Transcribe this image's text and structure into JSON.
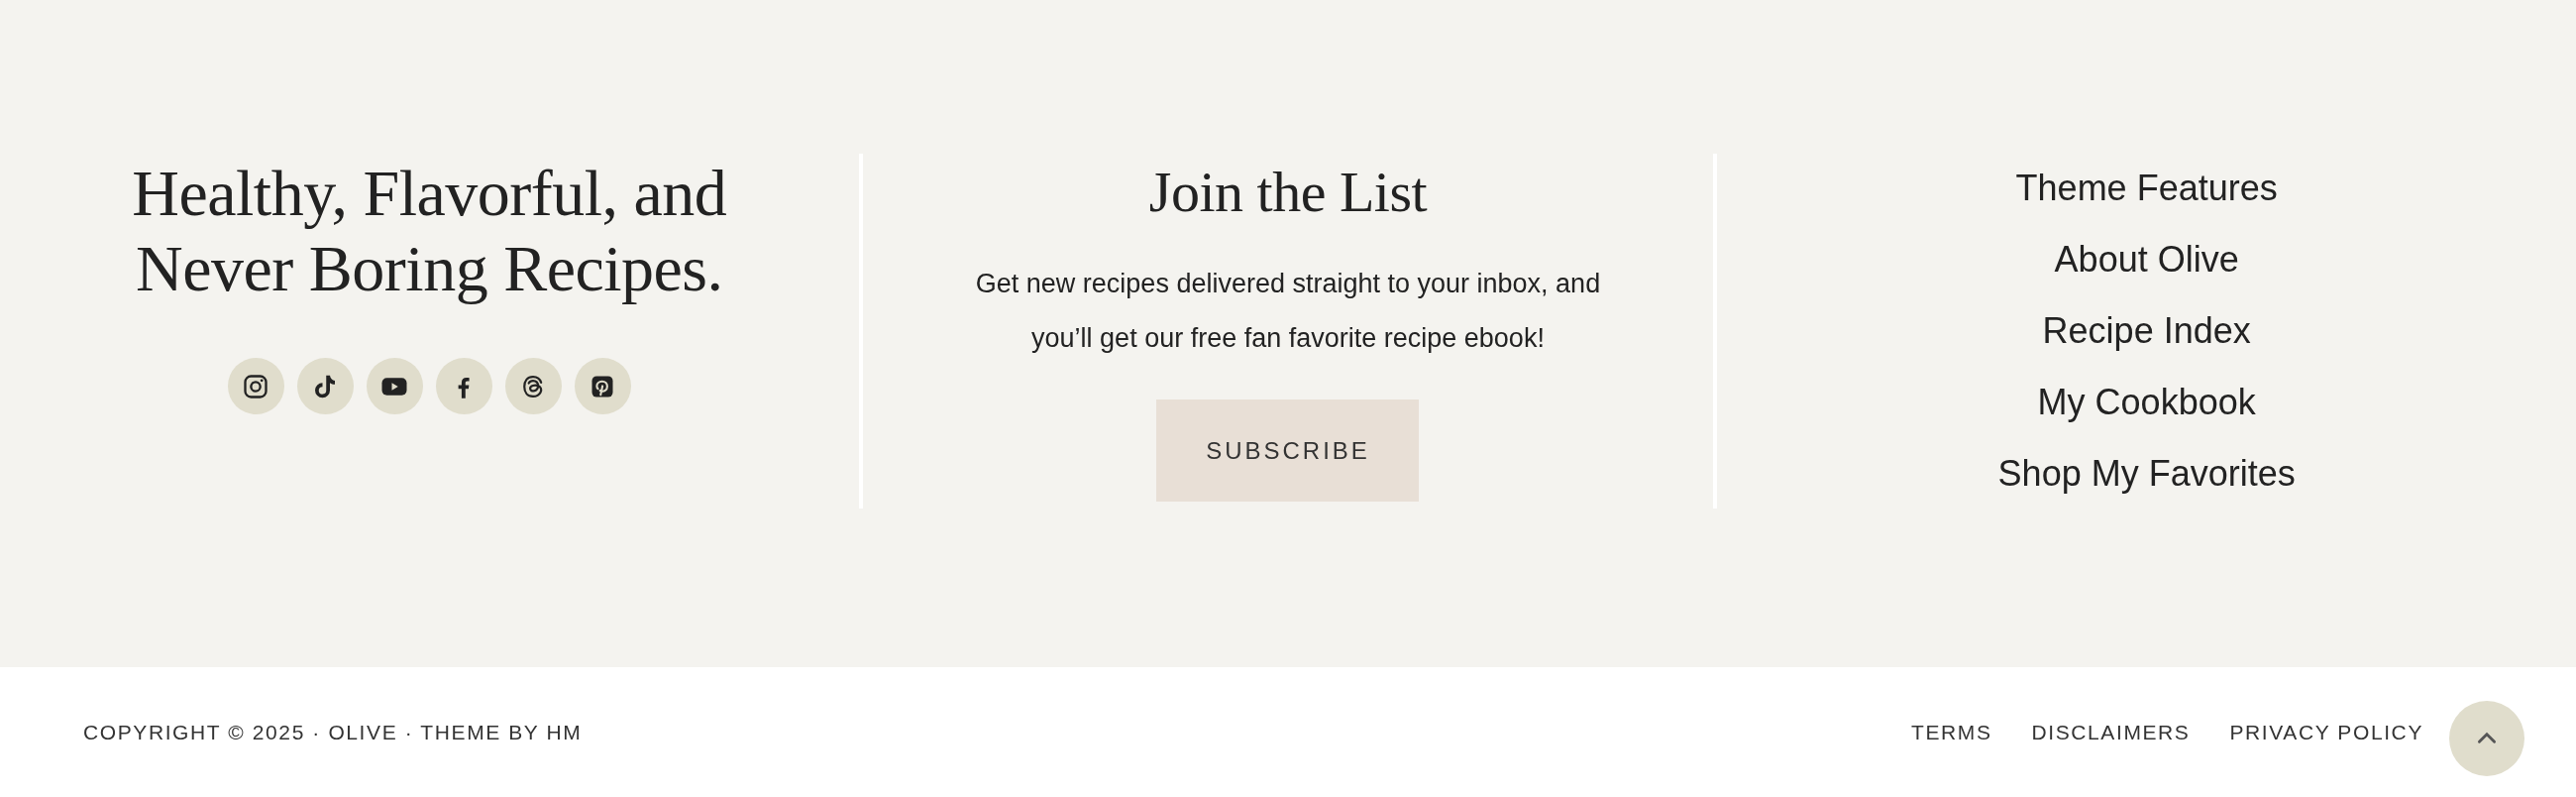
{
  "brand": {
    "heading_lines": [
      "Healthy, Flavorful, and",
      "Never Boring Recipes."
    ],
    "social_links": [
      {
        "kind": "instagram"
      },
      {
        "kind": "tiktok"
      },
      {
        "kind": "youtube"
      },
      {
        "kind": "facebook"
      },
      {
        "kind": "threads"
      },
      {
        "kind": "pinterest"
      }
    ]
  },
  "newsletter": {
    "title": "Join the List",
    "text": "Get new recipes delivered straight to your inbox, and you’ll get our free fan favorite recipe ebook!",
    "button": "SUBSCRIBE"
  },
  "footer_nav": [
    "Theme Features",
    "About Olive",
    "Recipe Index",
    "My Cookbook",
    "Shop My Favorites"
  ],
  "bottom_bar": {
    "copyright": "COPYRIGHT © 2025 · OLIVE · THEME BY HM",
    "links": [
      "TERMS",
      "DISCLAIMERS",
      "PRIVACY POLICY"
    ]
  }
}
